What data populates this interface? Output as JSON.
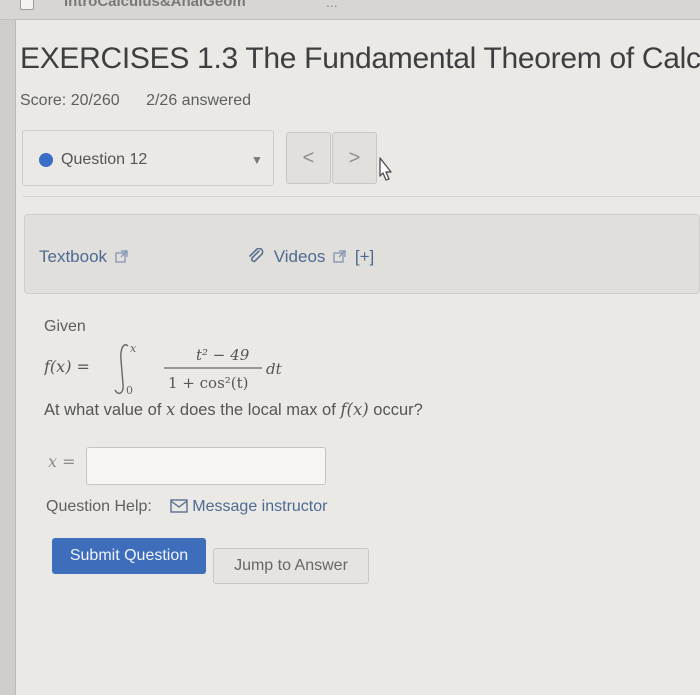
{
  "browser": {
    "tab_title": "IntroCalculus&AnalGeom",
    "tab_more": "..."
  },
  "header": {
    "title": "EXERCISES 1.3 The Fundamental Theorem of Calc",
    "score": "Score: 20/260",
    "answered": "2/26 answered"
  },
  "question_nav": {
    "label": "Question 12",
    "prev": "<",
    "next": ">"
  },
  "resources": {
    "textbook": "Textbook",
    "videos": "Videos",
    "expand": "[+]"
  },
  "problem": {
    "given": "Given",
    "question_prefix": "At what value of ",
    "question_var": "x",
    "question_mid": " does the local max of ",
    "question_func": "f(x)",
    "question_suffix": " occur?",
    "formula": {
      "lhs": "f(x) =",
      "upper": "x",
      "lower": "0",
      "numerator": "t² − 49",
      "denominator": "1 + cos²(t)",
      "dt": "dt"
    }
  },
  "answer": {
    "label": "x =",
    "value": ""
  },
  "help": {
    "label": "Question Help:",
    "message": "Message instructor"
  },
  "actions": {
    "submit": "Submit Question",
    "jump": "Jump to Answer"
  },
  "colors": {
    "accent": "#3d6dbb",
    "link": "#4d6a91"
  }
}
